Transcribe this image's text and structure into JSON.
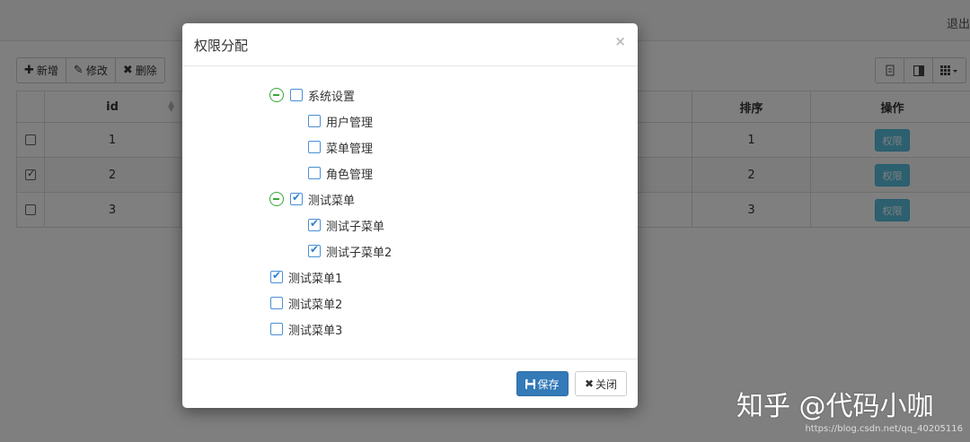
{
  "header": {
    "logout": "退出"
  },
  "toolbar": {
    "add": "新增",
    "edit": "修改",
    "delete": "删除"
  },
  "table": {
    "columns": {
      "id": "id",
      "sort": "排序",
      "action": "操作"
    },
    "rows": [
      {
        "checked": false,
        "id": "1",
        "sort": "1",
        "action": "权限"
      },
      {
        "checked": true,
        "id": "2",
        "sort": "2",
        "action": "权限"
      },
      {
        "checked": false,
        "id": "3",
        "sort": "3",
        "action": "权限"
      }
    ]
  },
  "modal": {
    "title": "权限分配",
    "close_symbol": "×",
    "tree": [
      {
        "label": "系统设置",
        "checked": false,
        "expanded": true,
        "children": [
          {
            "label": "用户管理",
            "checked": false
          },
          {
            "label": "菜单管理",
            "checked": false
          },
          {
            "label": "角色管理",
            "checked": false
          }
        ]
      },
      {
        "label": "测试菜单",
        "checked": true,
        "expanded": true,
        "children": [
          {
            "label": "测试子菜单",
            "checked": true
          },
          {
            "label": "测试子菜单2",
            "checked": true
          }
        ]
      },
      {
        "label": "测试菜单1",
        "checked": true
      },
      {
        "label": "测试菜单2",
        "checked": false
      },
      {
        "label": "测试菜单3",
        "checked": false
      }
    ],
    "save_label": "保存",
    "close_label": "关闭"
  },
  "watermark": {
    "brand": "知乎 @代码小咖",
    "url": "https://blog.csdn.net/qq_40205116"
  },
  "colors": {
    "primary": "#337ab7",
    "info": "#5bc0de",
    "tree_toggle": "#3aa53a",
    "checkbox": "#2f7fd0"
  }
}
